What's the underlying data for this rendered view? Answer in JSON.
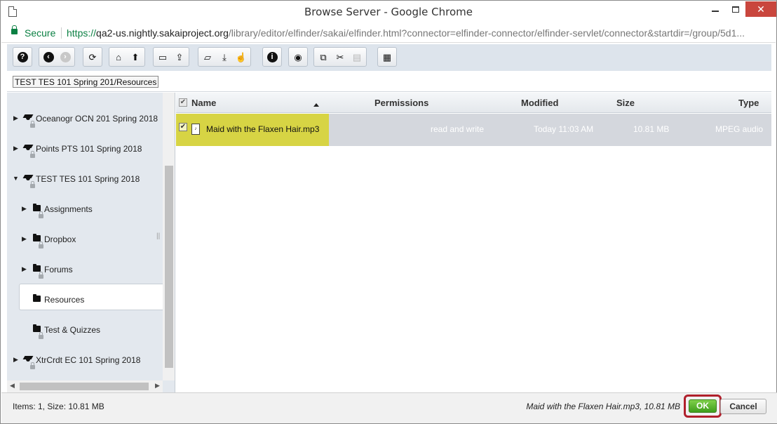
{
  "window": {
    "title": "Browse Server - Google Chrome"
  },
  "address": {
    "secure_label": "Secure",
    "scheme": "https://",
    "host": "qa2-us.nightly.sakaiproject.org",
    "path": "/library/editor/elfinder/sakai/elfinder.html?connector=elfinder-connector/elfinder-servlet/connector&startdir=/group/5d1..."
  },
  "toolbar": {
    "groups": [
      [
        "help-icon"
      ],
      [
        "back-icon",
        "forward-icon"
      ],
      [
        "reload-icon"
      ],
      [
        "home-icon",
        "up-icon"
      ],
      [
        "new-folder-icon",
        "upload-icon"
      ],
      [
        "open-icon",
        "download-icon",
        "select-icon"
      ],
      [
        "info-icon"
      ],
      [
        "preview-icon"
      ],
      [
        "copy-icon",
        "cut-icon",
        "paste-icon"
      ],
      [
        "view-icon"
      ]
    ]
  },
  "path": {
    "value": "TEST TES 101 Spring 201/Resources"
  },
  "tree": {
    "sites": [
      {
        "label": "Oceanogr OCN 201 Spring 2018"
      },
      {
        "label": "Points PTS 101 Spring 2018"
      },
      {
        "label": "TEST TES 101 Spring 2018"
      },
      {
        "label": "XtrCrdt EC 101 Spring 2018"
      }
    ],
    "folders": [
      {
        "label": "Assignments"
      },
      {
        "label": "Dropbox"
      },
      {
        "label": "Forums"
      },
      {
        "label": "Resources"
      },
      {
        "label": "Test & Quizzes"
      }
    ]
  },
  "list": {
    "columns": {
      "name": "Name",
      "permissions": "Permissions",
      "modified": "Modified",
      "size": "Size",
      "type": "Type"
    },
    "rows": [
      {
        "name": "Maid with the Flaxen Hair.mp3",
        "permissions": "read and write",
        "modified": "Today 11:03 AM",
        "size": "10.81 MB",
        "type": "MPEG audio",
        "selected": true
      }
    ]
  },
  "status": {
    "left": "Items: 1, Size: 10.81 MB",
    "right": "Maid with the Flaxen Hair.mp3, 10.81 MB"
  },
  "buttons": {
    "ok": "OK",
    "cancel": "Cancel"
  },
  "colors": {
    "highlight": "#d7d444",
    "ok_green": "#4caf28",
    "callout_red": "#b0202c",
    "secure_green": "#0b8043"
  }
}
